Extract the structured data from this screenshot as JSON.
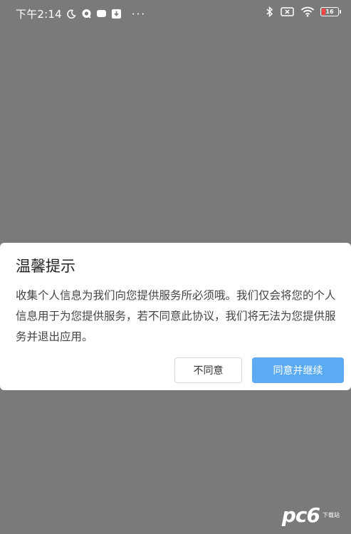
{
  "status_bar": {
    "time": "下午2:14",
    "icons_left": [
      "moon-icon",
      "message-icon",
      "chat-icon",
      "download-icon"
    ],
    "more": "···",
    "icons_right": [
      "bluetooth-icon",
      "sim-off-icon",
      "wifi-icon"
    ],
    "battery_level": "16",
    "battery_color": "#ff4444"
  },
  "dialog": {
    "title": "温馨提示",
    "body": "收集个人信息为我们向您提供服务所必须哦。我们仅会将您的个人信息用于为您提供服务，若不同意此协议，我们将无法为您提供服务并退出应用。",
    "decline_label": "不同意",
    "accept_label": "同意并继续",
    "accent_color": "#5aabf2"
  },
  "watermark": {
    "logo": "pc6",
    "sub": "下载站"
  }
}
